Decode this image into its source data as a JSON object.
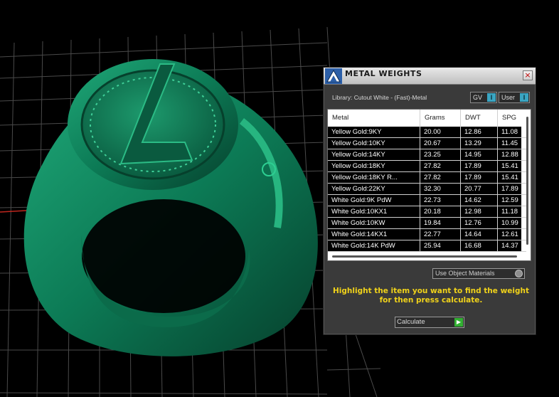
{
  "panel": {
    "title": "METAL WEIGHTS",
    "close_glyph": "×",
    "library_text": "Library: Cutout White - (Fast)-Metal",
    "toggle_gv": {
      "label": "GV",
      "indicator": "I"
    },
    "toggle_user": {
      "label": "User",
      "indicator": "I"
    },
    "use_object_materials_label": "Use Object Materials",
    "hint_text": "Highlight the item you want to find the weight for then press calculate.",
    "calculate_label": "Calculate",
    "calculate_arrow": "▶",
    "colors": {
      "accent": "#3aa5c2",
      "hint": "#f0d21a",
      "calc_arrow": "#33b033",
      "ring": "#0f7a56"
    }
  },
  "table": {
    "headers": [
      "Metal",
      "Grams",
      "DWT",
      "SPG"
    ],
    "rows": [
      [
        "Yellow Gold:9KY",
        "20.00",
        "12.86",
        "11.08"
      ],
      [
        "Yellow Gold:10KY",
        "20.67",
        "13.29",
        "11.45"
      ],
      [
        "Yellow Gold:14KY",
        "23.25",
        "14.95",
        "12.88"
      ],
      [
        "Yellow Gold:18KY",
        "27.82",
        "17.89",
        "15.41"
      ],
      [
        "Yellow Gold:18KY R...",
        "27.82",
        "17.89",
        "15.41"
      ],
      [
        "Yellow Gold:22KY",
        "32.30",
        "20.77",
        "17.89"
      ],
      [
        "White Gold:9K PdW",
        "22.73",
        "14.62",
        "12.59"
      ],
      [
        "White Gold:10KX1",
        "20.18",
        "12.98",
        "11.18"
      ],
      [
        "White Gold:10KW",
        "19.84",
        "12.76",
        "10.99"
      ],
      [
        "White Gold:14KX1",
        "22.77",
        "14.64",
        "12.61"
      ],
      [
        "White Gold:14K PdW",
        "25.94",
        "16.68",
        "14.37"
      ]
    ]
  }
}
